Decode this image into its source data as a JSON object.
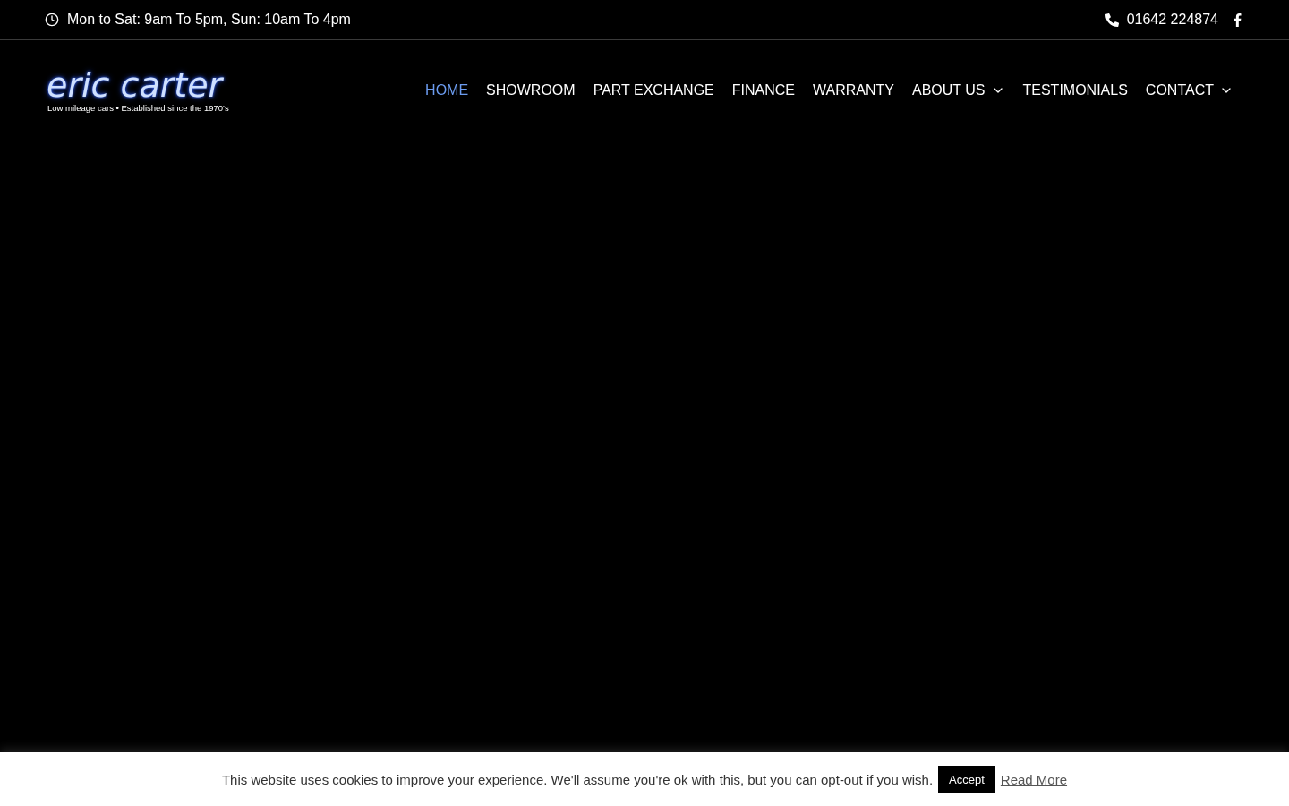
{
  "top_bar": {
    "hours": "Mon to Sat: 9am To 5pm, Sun: 10am To 4pm",
    "phone": "01642 224874"
  },
  "logo": {
    "name": "eric carter",
    "tagline": "Low mileage cars • Established since the 1970's"
  },
  "nav": [
    {
      "label": "HOME",
      "selected": true,
      "dropdown": false
    },
    {
      "label": "SHOWROOM",
      "selected": false,
      "dropdown": false
    },
    {
      "label": "PART EXCHANGE",
      "selected": false,
      "dropdown": false
    },
    {
      "label": "FINANCE",
      "selected": false,
      "dropdown": false
    },
    {
      "label": "WARRANTY",
      "selected": false,
      "dropdown": false
    },
    {
      "label": "ABOUT US",
      "selected": false,
      "dropdown": true
    },
    {
      "label": "TESTIMONIALS",
      "selected": false,
      "dropdown": false
    },
    {
      "label": "CONTACT",
      "selected": false,
      "dropdown": true
    }
  ],
  "cookie_bar": {
    "message": "This website uses cookies to improve your experience. We'll assume you're ok with this, but you can opt-out if you wish.",
    "accept": "Accept",
    "read_more": "Read More"
  }
}
